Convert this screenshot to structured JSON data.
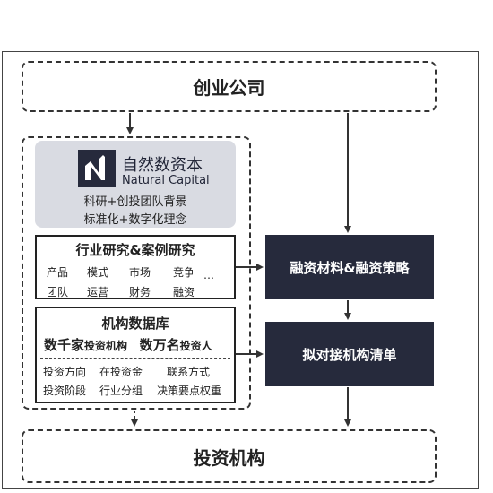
{
  "top": {
    "label": "创业公司"
  },
  "bottom": {
    "label": "投资机构"
  },
  "brand": {
    "name_cn": "自然数资本",
    "name_en": "Natural Capital",
    "line1": "科研+创投团队背景",
    "line2": "标准化+数字化理念",
    "logo_color": "#262a3c"
  },
  "research": {
    "title": "行业研究&案例研究",
    "row1": [
      "产品",
      "模式",
      "市场",
      "竞争"
    ],
    "ellipsis": "…",
    "row2": [
      "团队",
      "运营",
      "财务",
      "融资"
    ]
  },
  "database": {
    "title": "机构数据库",
    "stat1_big": "数千家",
    "stat1_small": "投资机构",
    "stat2_big": "数万名",
    "stat2_small": "投资人",
    "row1": [
      "投资方向",
      "在投资金",
      "联系方式"
    ],
    "row2": [
      "投资阶段",
      "行业分组",
      "决策要点权重"
    ]
  },
  "financing": {
    "label": "融资材料&融资策略"
  },
  "list": {
    "label": "拟对接机构清单"
  },
  "colors": {
    "dark": "#262a3c",
    "logo_bg": "#d9dbe2"
  }
}
